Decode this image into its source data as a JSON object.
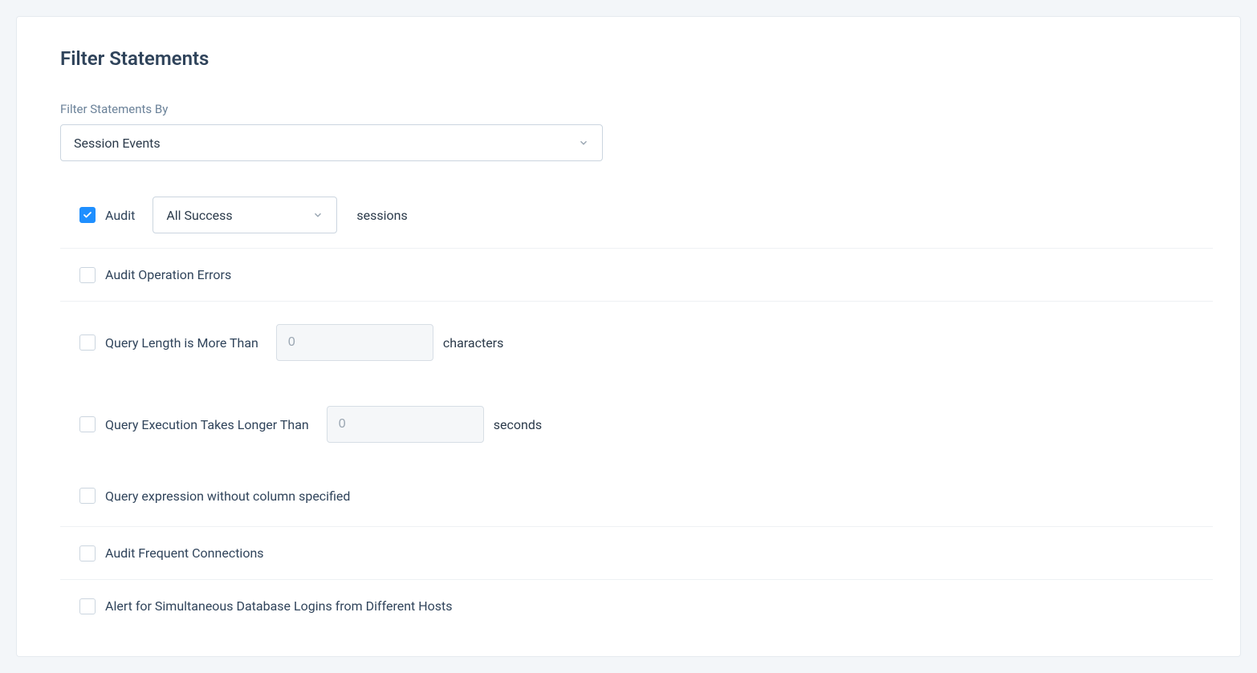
{
  "card": {
    "title": "Filter Statements",
    "filter_by_label": "Filter Statements By",
    "filter_by_value": "Session Events"
  },
  "rows": {
    "audit": {
      "checked": true,
      "label": "Audit",
      "select_value": "All Success",
      "suffix": "sessions"
    },
    "audit_errors": {
      "checked": false,
      "label": "Audit Operation Errors"
    },
    "query_length": {
      "checked": false,
      "label": "Query Length is More Than",
      "placeholder": "0",
      "suffix": "characters"
    },
    "query_exec": {
      "checked": false,
      "label": "Query Execution Takes Longer Than",
      "placeholder": "0",
      "suffix": "seconds"
    },
    "query_expr": {
      "checked": false,
      "label": "Query expression without column specified"
    },
    "frequent": {
      "checked": false,
      "label": "Audit Frequent Connections"
    },
    "simultaneous": {
      "checked": false,
      "label": "Alert for Simultaneous Database Logins from Different Hosts"
    }
  }
}
